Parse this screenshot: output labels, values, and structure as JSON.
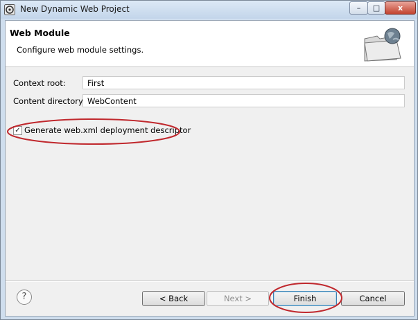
{
  "window": {
    "title": "New Dynamic Web Project",
    "controls": {
      "minimize": "–",
      "maximize": "□",
      "close": "x"
    }
  },
  "banner": {
    "title": "Web Module",
    "description": "Configure web module settings.",
    "icon": "folder-globe-icon"
  },
  "form": {
    "context_root_label": "Context root:",
    "context_root_value": "First",
    "content_dir_label": "Content directory:",
    "content_dir_value": "WebContent",
    "generate_descriptor_label": "Generate web.xml deployment descriptor",
    "generate_descriptor_checked": true,
    "check_glyph": "✓"
  },
  "buttons": {
    "help": "?",
    "back": "< Back",
    "next": "Next >",
    "finish": "Finish",
    "cancel": "Cancel"
  },
  "colors": {
    "annotation": "#c0282d",
    "titlebar": "#c9d9ec",
    "close_button": "#c2432f"
  }
}
